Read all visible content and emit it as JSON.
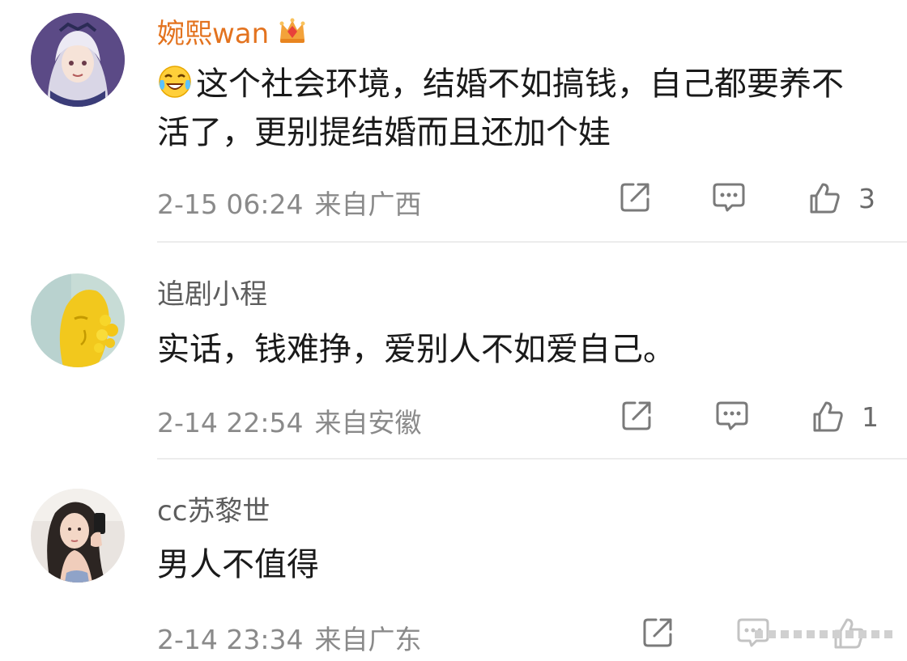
{
  "comments": [
    {
      "username": "婉熙wan",
      "vip": true,
      "badge_icon": "vip-crown-icon",
      "emoji_icon": "laughing-tears-emoji-icon",
      "text": "这个社会环境，结婚不如搞钱，自己都要养不活了，更别提结婚而且还加个娃",
      "date": "2-15 06:24",
      "location": "来自广西",
      "likes": "3"
    },
    {
      "username": "追剧小程",
      "vip": false,
      "text": "实话，钱难挣，爱别人不如爱自己。",
      "date": "2-14 22:54",
      "location": "来自安徽",
      "likes": "1"
    },
    {
      "username": "cc苏黎世",
      "vip": false,
      "text": "男人不值得",
      "date": "2-14 23:34",
      "location": "来自广东",
      "likes": ""
    }
  ],
  "icons": {
    "share": "share-icon",
    "comment": "comment-icon",
    "like": "thumbs-up-icon"
  },
  "colors": {
    "vip_username": "#e3731f",
    "username": "#5d5d5d",
    "text": "#1a1a1a",
    "meta": "#8a8a8a",
    "divider": "#ececec"
  }
}
